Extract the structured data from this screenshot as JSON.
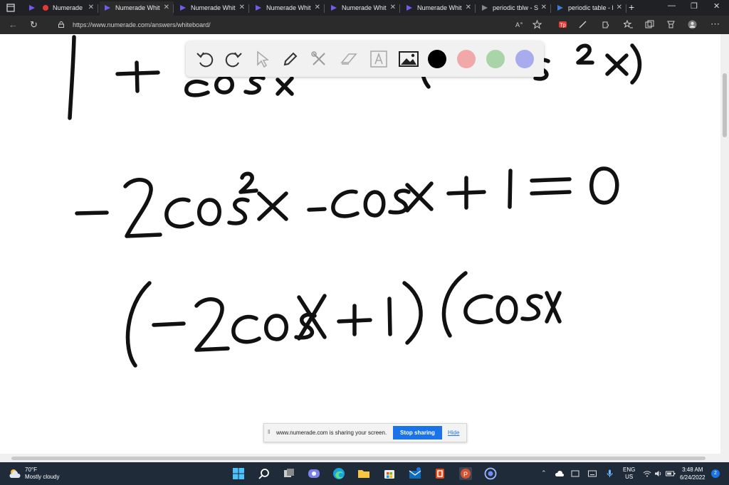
{
  "browser": {
    "tabs": [
      {
        "label": "Numerade",
        "active": false
      },
      {
        "label": "Numerade Whit",
        "active": true
      },
      {
        "label": "Numerade Whit",
        "active": false
      },
      {
        "label": "Numerade Whit",
        "active": false
      },
      {
        "label": "Numerade Whit",
        "active": false
      },
      {
        "label": "Numerade Whit",
        "active": false
      },
      {
        "label": "periodic tblw - S",
        "active": false
      },
      {
        "label": "periodic table - l",
        "active": false
      }
    ],
    "url": "https://www.numerade.com/answers/whiteboard/"
  },
  "toolbar": {
    "tools": [
      "undo-icon",
      "redo-icon",
      "pointer-icon",
      "pen-icon",
      "tools-icon",
      "eraser-icon",
      "text-icon",
      "image-icon"
    ],
    "colors": [
      "#000000",
      "#f0a8a8",
      "#a8d4a8",
      "#a8acec"
    ]
  },
  "share_bar": {
    "message": "www.numerade.com is sharing your screen.",
    "stop_label": "Stop sharing",
    "hide_label": "Hide"
  },
  "taskbar": {
    "weather_temp": "70°F",
    "weather_desc": "Mostly cloudy",
    "lang_top": "ENG",
    "lang_bottom": "US",
    "time": "3:48 AM",
    "date": "6/24/2022",
    "notification_count": "2"
  }
}
